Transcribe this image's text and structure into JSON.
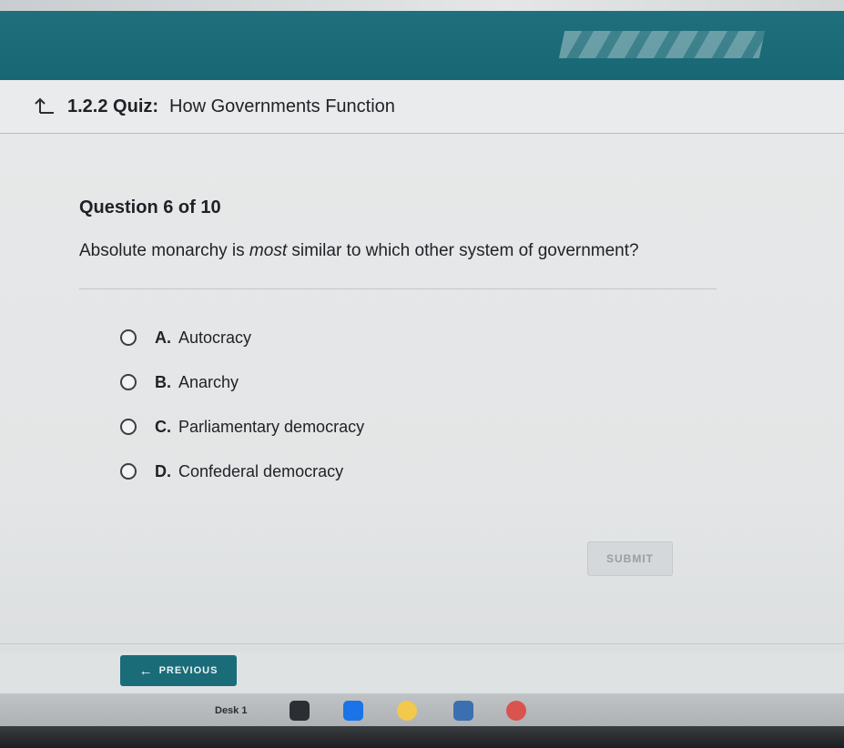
{
  "header": {
    "quiz_code": "1.2.2 Quiz:",
    "quiz_title": "How Governments Function"
  },
  "question": {
    "number_label": "Question 6 of 10",
    "text_before": "Absolute monarchy is ",
    "text_emphasis": "most",
    "text_after": " similar to which other system of government?"
  },
  "options": [
    {
      "letter": "A.",
      "text": "Autocracy"
    },
    {
      "letter": "B.",
      "text": "Anarchy"
    },
    {
      "letter": "C.",
      "text": "Parliamentary democracy"
    },
    {
      "letter": "D.",
      "text": "Confederal democracy"
    }
  ],
  "buttons": {
    "submit_label": "SUBMIT",
    "previous_label": "PREVIOUS"
  },
  "taskbar": {
    "desk_label": "Desk 1",
    "apps": [
      {
        "icon": "files-icon",
        "color": "#2b2f33"
      },
      {
        "icon": "folder-icon",
        "color": "#1a73e8"
      },
      {
        "icon": "chrome-icon",
        "color": "#f2c94c"
      },
      {
        "icon": "screen-app-icon",
        "color": "#3c6fb0"
      },
      {
        "icon": "app-icon",
        "color": "#d9534f"
      }
    ]
  },
  "colors": {
    "brand": "#1b6c79",
    "background": "#e6e8e9"
  }
}
